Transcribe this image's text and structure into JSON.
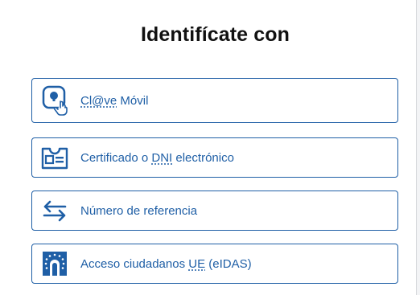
{
  "page": {
    "title": "Identifícate con"
  },
  "options": [
    {
      "id": "clave-movil",
      "label_abbr": "Cl@ve",
      "label_rest": " Móvil",
      "icon": "clave-phone-hand-icon"
    },
    {
      "id": "certificado",
      "label_pre": "Certificado o ",
      "label_abbr": "DNI",
      "label_post": " electrónico",
      "icon": "id-card-icon"
    },
    {
      "id": "referencia",
      "label": "Número de referencia",
      "icon": "transfer-arrows-icon"
    },
    {
      "id": "eidas",
      "label_pre": "Acceso ciudadanos ",
      "label_abbr": "UE",
      "label_post": " (eIDAS)",
      "icon": "eu-stars-door-icon"
    }
  ],
  "colors": {
    "accent": "#1f5fa6",
    "title": "#111111",
    "background": "#ffffff"
  }
}
